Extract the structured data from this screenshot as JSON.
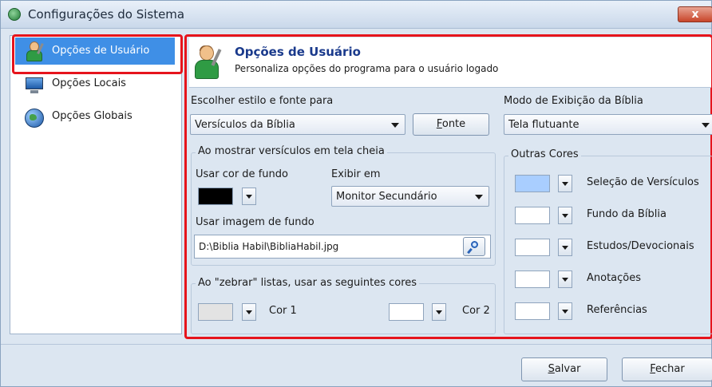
{
  "window": {
    "title": "Configurações do Sistema",
    "close_label": "x"
  },
  "sidebar": {
    "items": [
      {
        "label": "Opções de Usuário",
        "icon": "user-settings-icon",
        "selected": true
      },
      {
        "label": "Opções Locais",
        "icon": "monitor-icon",
        "selected": false
      },
      {
        "label": "Opções Globais",
        "icon": "globe-icon",
        "selected": false
      }
    ]
  },
  "header": {
    "title": "Opções de Usuário",
    "subtitle": "Personaliza opções do programa para o usuário logado",
    "icon": "user-settings-icon"
  },
  "style": {
    "label": "Escolher estilo e fonte para",
    "select_value": "Versículos da Bíblia",
    "font_button": "Fonte",
    "font_button_mnemonic": "F"
  },
  "display_mode": {
    "label": "Modo de Exibição da Bíblia",
    "value": "Tela flutuante"
  },
  "fullscreen": {
    "group_title": "Ao mostrar versículos em tela cheia",
    "bg_color_label": "Usar cor de fundo",
    "bg_color": "#000000",
    "show_in_label": "Exibir em",
    "show_in_value": "Monitor Secundário",
    "bg_image_label": "Usar imagem de fundo",
    "bg_image_path": "D:\\Biblia Habil\\BibliaHabil.jpg"
  },
  "zebra": {
    "group_title": "Ao \"zebrar\" listas, usar as seguintes cores",
    "color1_label": "Cor 1",
    "color1": "#e3e3e3",
    "color2_label": "Cor 2",
    "color2": "#ffffff"
  },
  "other_colors": {
    "group_title": "Outras Cores",
    "items": [
      {
        "label": "Seleção de Versículos",
        "color": "#a9ceff"
      },
      {
        "label": "Fundo da Bíblia",
        "color": "#ffffff"
      },
      {
        "label": "Estudos/Devocionais",
        "color": "#ffffff"
      },
      {
        "label": "Anotações",
        "color": "#ffffff"
      },
      {
        "label": "Referências",
        "color": "#ffffff"
      }
    ]
  },
  "footer": {
    "save_rest": "alvar",
    "save_mn": "S",
    "close_rest": "echar",
    "close_mn": "F"
  },
  "colors": {
    "highlight_border": "#e6141c",
    "selection": "#3f8fe6",
    "header_title": "#1a3a8c"
  }
}
